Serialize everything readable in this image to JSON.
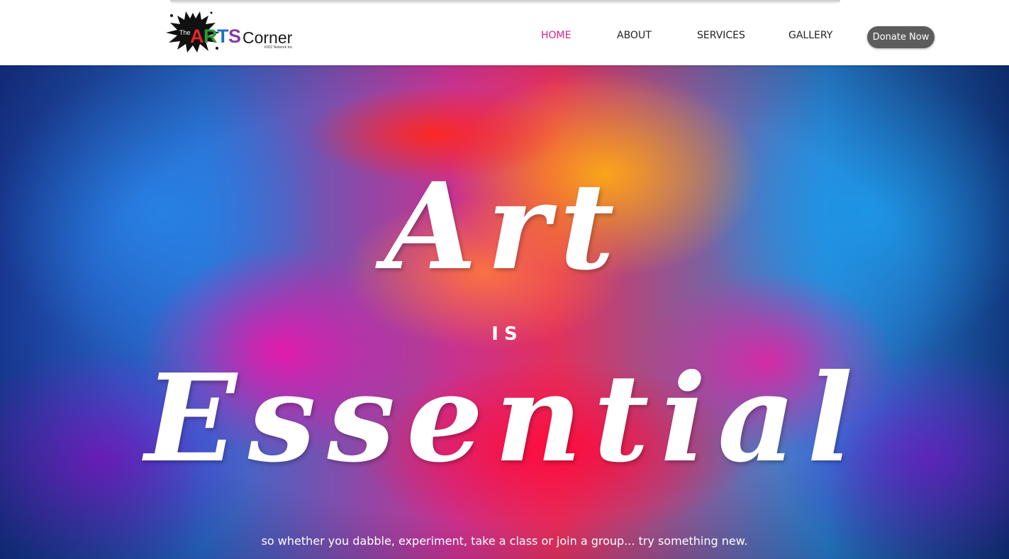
{
  "header": {
    "logo": {
      "small_text": "The",
      "arts_letters": [
        {
          "char": "A",
          "color": "#e4262b"
        },
        {
          "char": "R",
          "color": "#2e9a3a"
        },
        {
          "char": "T",
          "color": "#1f6fbf"
        },
        {
          "char": "S",
          "color": "#8b3aa0"
        }
      ],
      "corner_text": "Corner",
      "tagline": "KIDZ Network Inc."
    },
    "nav": [
      {
        "label": "HOME",
        "active": true
      },
      {
        "label": "ABOUT",
        "active": false
      },
      {
        "label": "SERVICES",
        "active": false
      },
      {
        "label": "GALLERY",
        "active": false
      }
    ],
    "donate_label": "Donate Now"
  },
  "hero": {
    "line1": "Art",
    "line2": "is",
    "line3": "Essential",
    "tagline": "so whether you dabble, experiment, take a class or join a group... try something new."
  },
  "colors": {
    "accent": "#d6208f",
    "donate_bg": "#5c5c5c",
    "hero_text": "#ffffff"
  }
}
